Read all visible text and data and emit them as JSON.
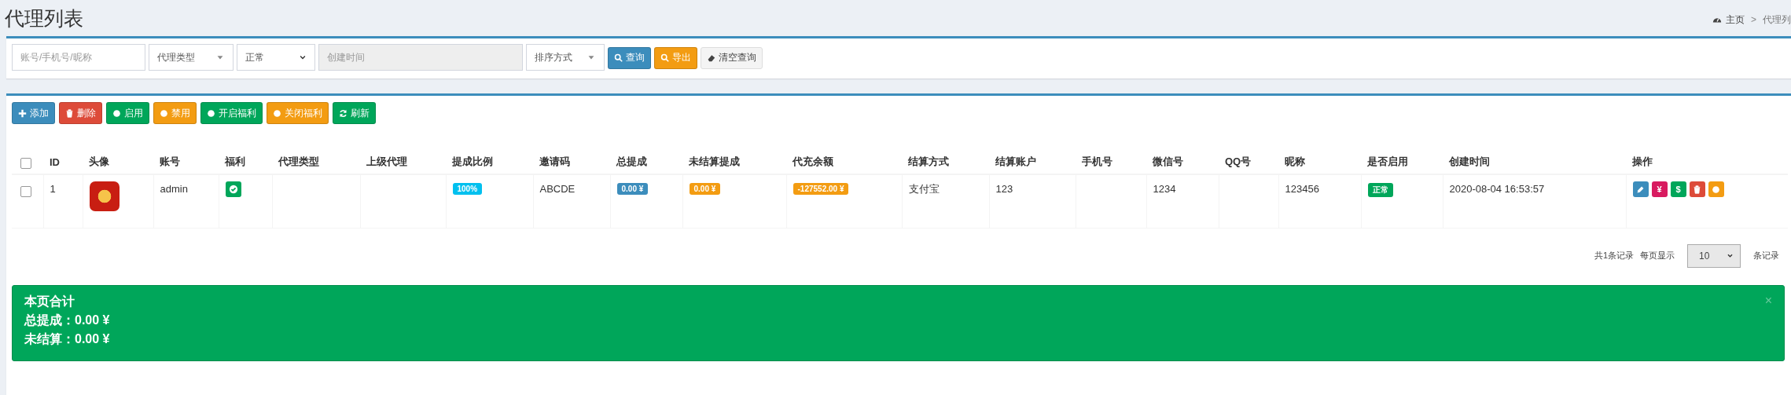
{
  "page_title": "代理列表",
  "breadcrumb": {
    "items": [
      {
        "kind": "home",
        "label": "主页"
      },
      {
        "kind": "current",
        "label": "代理列"
      }
    ],
    "separator": ">"
  },
  "filters": [
    {
      "kind": "input",
      "placeholder": "账号/手机号/昵称"
    },
    {
      "kind": "select2",
      "value": "代理类型"
    },
    {
      "kind": "select",
      "value": "正常"
    },
    {
      "kind": "date",
      "placeholder": "创建时间",
      "disabled": true
    },
    {
      "kind": "select2",
      "value": "排序方式"
    }
  ],
  "filter_buttons": [
    {
      "label": "查询",
      "kind": "search",
      "color": "#3c8dbc"
    },
    {
      "label": "导出",
      "kind": "export",
      "color": "#f39c12"
    },
    {
      "label": "清空查询",
      "kind": "clear",
      "color": "#f4f4f4"
    }
  ],
  "toolbar": [
    {
      "label": "添加",
      "kind": "add",
      "color": "#3c8dbc"
    },
    {
      "label": "删除",
      "kind": "delete",
      "color": "#dd4b39"
    },
    {
      "label": "启用",
      "kind": "toggle",
      "color": "#00a65a"
    },
    {
      "label": "禁用",
      "kind": "toggle",
      "color": "#f39c12"
    },
    {
      "label": "开启福利",
      "kind": "toggle",
      "color": "#00a65a"
    },
    {
      "label": "关闭福利",
      "kind": "toggle",
      "color": "#f39c12"
    },
    {
      "label": "刷新",
      "kind": "refresh",
      "color": "#00a65a"
    }
  ],
  "table": {
    "select_all_checked": false,
    "columns": [
      "ID",
      "头像",
      "账号",
      "福利",
      "代理类型",
      "上级代理",
      "提成比例",
      "邀请码",
      "总提成",
      "未结算提成",
      "代充余额",
      "结算方式",
      "结算账户",
      "手机号",
      "微信号",
      "QQ号",
      "昵称",
      "是否启用",
      "创建时间",
      "操作"
    ],
    "rows": [
      {
        "checked": false,
        "cells": [
          {
            "kind": "text",
            "text": "1"
          },
          {
            "kind": "avatar"
          },
          {
            "kind": "text",
            "text": "admin"
          },
          {
            "kind": "check",
            "color": "#00a65a"
          },
          {
            "kind": "blank"
          },
          {
            "kind": "blank"
          },
          {
            "kind": "badge",
            "text": "100%",
            "color": "#00c0ef"
          },
          {
            "kind": "text",
            "text": "ABCDE"
          },
          {
            "kind": "badge",
            "text": "0.00 ¥",
            "color": "#3c8dbc"
          },
          {
            "kind": "badge",
            "text": "0.00 ¥",
            "color": "#f39c12"
          },
          {
            "kind": "badge",
            "text": "-127552.00 ¥",
            "color": "#f39c12"
          },
          {
            "kind": "text",
            "text": "支付宝"
          },
          {
            "kind": "text",
            "text": "123"
          },
          {
            "kind": "blank"
          },
          {
            "kind": "text",
            "text": "1234"
          },
          {
            "kind": "blank"
          },
          {
            "kind": "text",
            "text": "123456"
          },
          {
            "kind": "badge",
            "text": "正常",
            "color": "#00a65a"
          },
          {
            "kind": "text",
            "text": "2020-08-04 16:53:57"
          },
          {
            "kind": "actions",
            "actions": [
              {
                "kind": "edit",
                "color": "#3c8dbc"
              },
              {
                "kind": "symbol",
                "label": "¥",
                "color": "#d81b60"
              },
              {
                "kind": "symbol",
                "label": "$",
                "color": "#00a65a"
              },
              {
                "kind": "delete",
                "color": "#dd4b39"
              },
              {
                "kind": "toggle",
                "color": "#f39c12"
              }
            ]
          }
        ]
      }
    ]
  },
  "pagination": {
    "total": "共1条记录",
    "per_page_label": "每页显示",
    "page_size": "10",
    "suffix": "条记录"
  },
  "summary": {
    "title": "本页合计",
    "lines": [
      "总提成：0.00 ¥",
      "未结算：0.00 ¥"
    ],
    "close": "×"
  }
}
